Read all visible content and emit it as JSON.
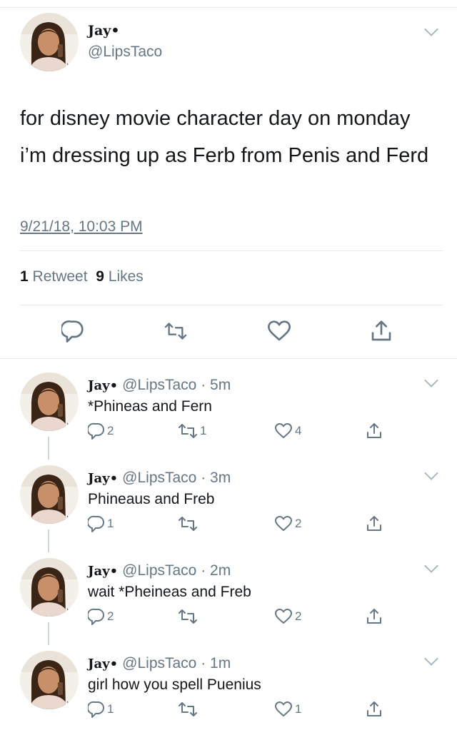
{
  "tweet": {
    "display_name": "Jay•",
    "handle": "@LipsTaco",
    "text": "for disney movie character day on monday i’m dressing up as Ferb from Penis and Ferd",
    "timestamp": "9/21/18, 10:03 PM",
    "retweets_count": "1",
    "retweets_label": "Retweet",
    "likes_count": "9",
    "likes_label": "Likes"
  },
  "replies": [
    {
      "display_name": "Jay•",
      "meta": "@LipsTaco · 5m",
      "text": "*Phineas and Fern",
      "reply_count": "2",
      "retweet_count": "1",
      "like_count": "4"
    },
    {
      "display_name": "Jay•",
      "meta": "@LipsTaco · 3m",
      "text": "Phineaus and Freb",
      "reply_count": "1",
      "retweet_count": "",
      "like_count": "2"
    },
    {
      "display_name": "Jay•",
      "meta": "@LipsTaco · 2m",
      "text": "wait *Pheineas and Freb",
      "reply_count": "2",
      "retweet_count": "",
      "like_count": "2"
    },
    {
      "display_name": "Jay•",
      "meta": "@LipsTaco · 1m",
      "text": "girl how you spell Puenius",
      "reply_count": "1",
      "retweet_count": "",
      "like_count": "1"
    }
  ],
  "icons": {
    "reply": "reply-icon",
    "retweet": "retweet-icon",
    "like": "heart-icon",
    "share": "share-icon",
    "more": "chevron-down-icon"
  },
  "colors": {
    "text": "#14171a",
    "secondary": "#657786",
    "divider": "#e6ecf0"
  }
}
